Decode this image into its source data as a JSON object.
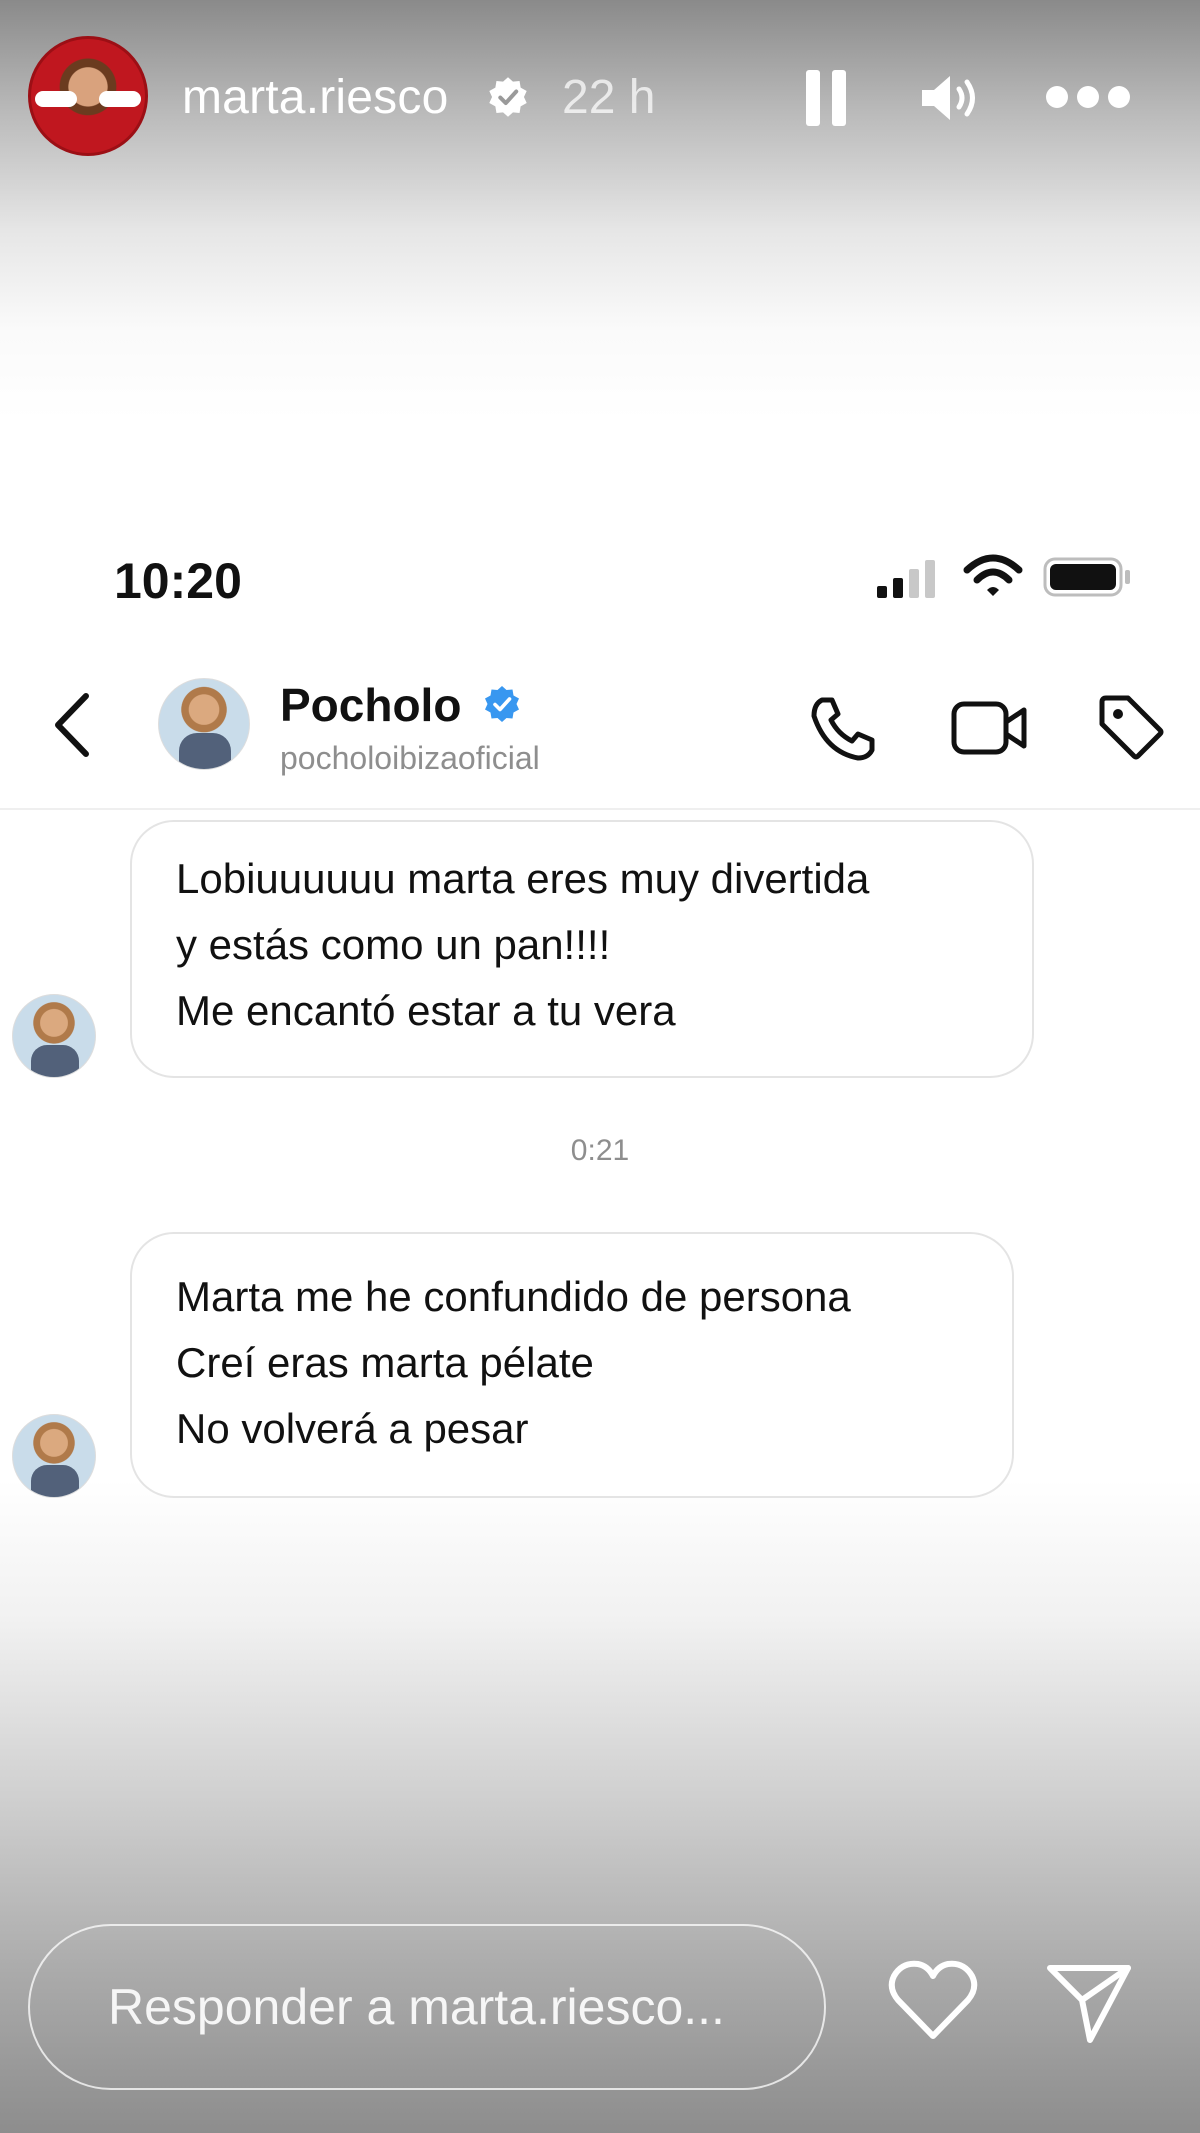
{
  "story": {
    "username": "marta.riesco",
    "time_ago": "22 h",
    "verified": true
  },
  "phone_status": {
    "time": "10:20"
  },
  "chat": {
    "contact_name": "Pocholo",
    "contact_handle": "pocholoibizaoficial",
    "verified": true
  },
  "messages": [
    {
      "lines": [
        "Lobiuuuuuu marta eres muy divertida",
        "y estás como un pan!!!!",
        "Me encantó estar a tu vera"
      ]
    },
    {
      "lines": [
        "Marta me he confundido de persona",
        "Creí eras marta pélate",
        "No volverá a pesar"
      ]
    }
  ],
  "timestamp": "0:21",
  "reply": {
    "placeholder": "Responder a marta.riesco..."
  },
  "icons": {
    "header": [
      "verified-icon",
      "pause-icon",
      "volume-icon",
      "more-icon"
    ],
    "status_bar": [
      "signal-icon",
      "wifi-icon",
      "battery-icon"
    ],
    "chat_header": [
      "back-icon",
      "call-icon",
      "video-icon",
      "tag-icon"
    ],
    "footer": [
      "heart-icon",
      "send-icon"
    ]
  },
  "colors": {
    "verified_blue": "#3897f0",
    "timestamp_gray": "#8e8e8e",
    "bubble_border": "#e4e4e4"
  }
}
